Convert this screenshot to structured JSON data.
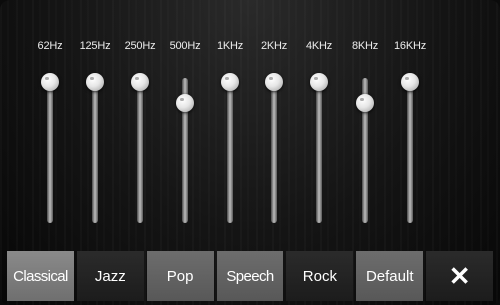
{
  "equalizer": {
    "bands": [
      {
        "label": "62Hz",
        "level": 0.97
      },
      {
        "label": "125Hz",
        "level": 0.97
      },
      {
        "label": "250Hz",
        "level": 0.97
      },
      {
        "label": "500Hz",
        "level": 0.83
      },
      {
        "label": "1KHz",
        "level": 0.97
      },
      {
        "label": "2KHz",
        "level": 0.97
      },
      {
        "label": "4KHz",
        "level": 0.97
      },
      {
        "label": "8KHz",
        "level": 0.83
      },
      {
        "label": "16KHz",
        "level": 0.97
      }
    ]
  },
  "presets": {
    "selected": "Classical",
    "items": [
      {
        "label": "Classical"
      },
      {
        "label": "Jazz"
      },
      {
        "label": "Pop"
      },
      {
        "label": "Speech"
      },
      {
        "label": "Rock"
      },
      {
        "label": "Default"
      }
    ],
    "close_icon": "close-icon"
  }
}
